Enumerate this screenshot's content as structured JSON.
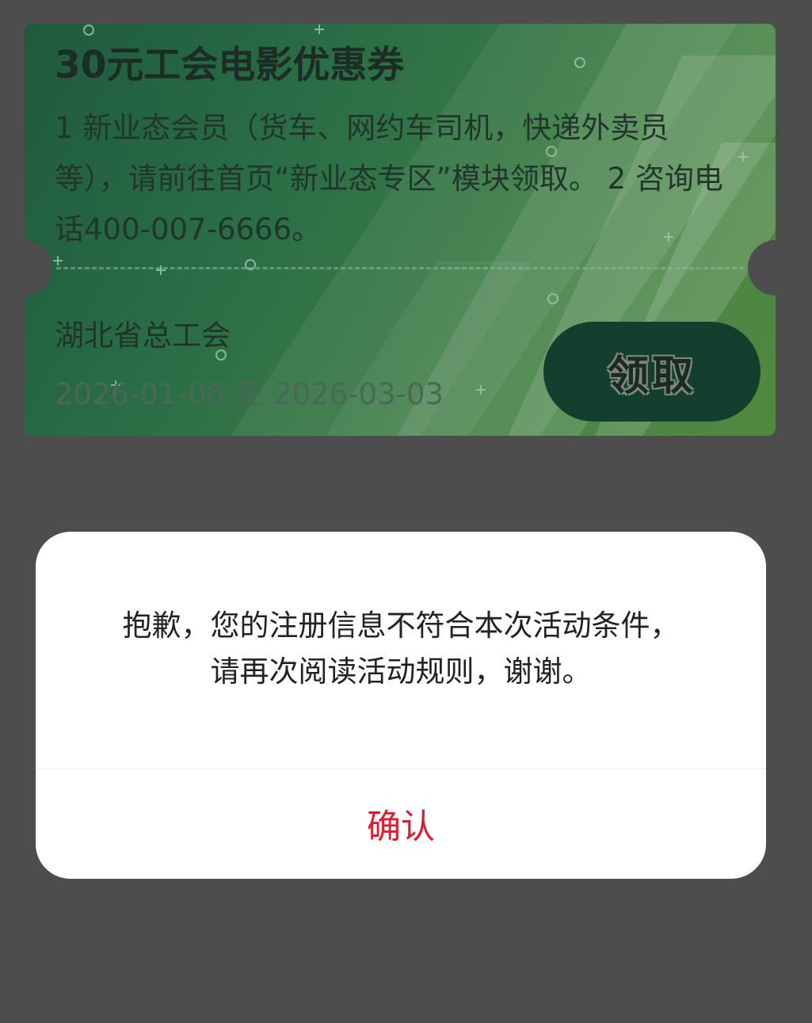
{
  "coupon": {
    "title": "30元工会电影优惠券",
    "description": "1 新业态会员（货车、网约车司机，快递外卖员等），请前往首页“新业态专区”模块领取。 2 咨询电话400-007-6666。",
    "issuer": "湖北省总工会",
    "valid_from": "2026-01-06",
    "valid_sep": "至",
    "valid_to": "2026-03-03",
    "claim_label": "领取"
  },
  "dialog": {
    "message_line1": "抱歉，您的注册信息不符合本次活动条件，",
    "message_line2": "请再次阅读活动规则，谢谢。",
    "confirm_label": "确认"
  },
  "colors": {
    "overlay": "#4d4d4d",
    "coupon_green": "#2b6e46",
    "button_green": "#143f2e",
    "confirm_red": "#e11a2e"
  }
}
